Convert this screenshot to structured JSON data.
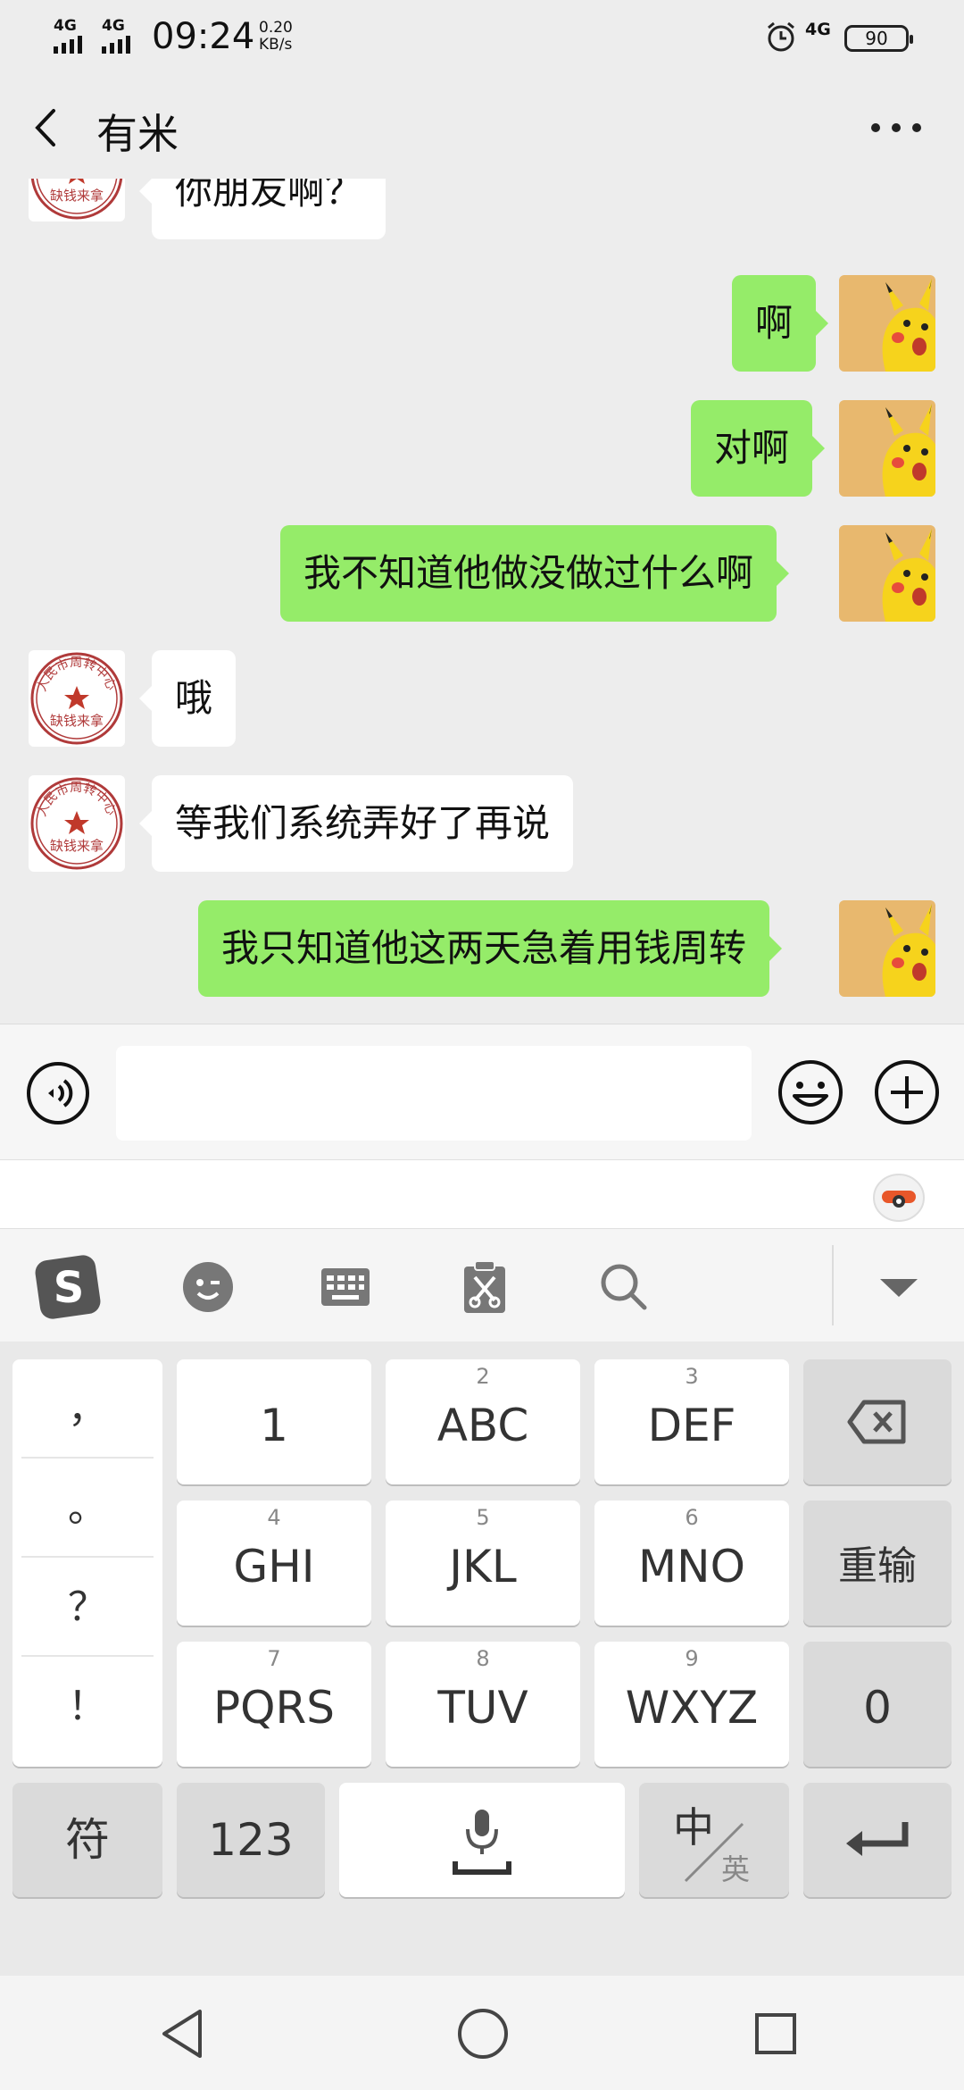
{
  "status_bar": {
    "sim1": "4G",
    "sim2": "4G",
    "time": "09:24",
    "speed_value": "0.20",
    "speed_unit": "KB/s",
    "network": "4G",
    "battery": "90"
  },
  "header": {
    "title": "有米",
    "icons": [
      "chevron-left-icon",
      "more-icon"
    ]
  },
  "chat": {
    "messages": [
      {
        "side": "in",
        "text": "你朋友啊？"
      },
      {
        "side": "out",
        "text": "啊"
      },
      {
        "side": "out",
        "text": "对啊"
      },
      {
        "side": "out",
        "text": "我不知道他做没做过什么啊"
      },
      {
        "side": "in",
        "text": "哦"
      },
      {
        "side": "in",
        "text": "等我们系统弄好了再说"
      },
      {
        "side": "out",
        "text": "我只知道他这两天急着用钱周转"
      }
    ],
    "stamp_avatar": {
      "top_text": "人民市周转中心",
      "bottom_text": "缺钱来拿"
    }
  },
  "input_bar": {
    "value": "",
    "icons": [
      "voice-icon",
      "emoji-icon",
      "plus-icon"
    ]
  },
  "keyboard_toolbar": {
    "icons": [
      "sogou-logo-icon",
      "emoji-wink-icon",
      "keyboard-icon",
      "clipboard-scissors-icon",
      "search-icon",
      "collapse-icon"
    ]
  },
  "keyboard": {
    "punctuation": [
      "，",
      "。",
      "？",
      "！"
    ],
    "keys": [
      {
        "num": "",
        "label": "1"
      },
      {
        "num": "2",
        "label": "ABC"
      },
      {
        "num": "3",
        "label": "DEF"
      },
      {
        "num": "4",
        "label": "GHI"
      },
      {
        "num": "5",
        "label": "JKL"
      },
      {
        "num": "6",
        "label": "MNO"
      },
      {
        "num": "7",
        "label": "PQRS"
      },
      {
        "num": "8",
        "label": "TUV"
      },
      {
        "num": "9",
        "label": "WXYZ"
      }
    ],
    "reinput": "重输",
    "zero": "0",
    "symbols": "符",
    "numbers": "123",
    "lang_primary": "中",
    "lang_secondary": "英"
  },
  "nav_bar": {
    "icons": [
      "back-triangle-icon",
      "home-circle-icon",
      "recents-square-icon"
    ]
  },
  "colors": {
    "outgoing": "#95ec69",
    "incoming": "#ffffff",
    "background": "#ededed",
    "stamp": "#c0392b",
    "avatar_bg": "#e8b86e"
  }
}
